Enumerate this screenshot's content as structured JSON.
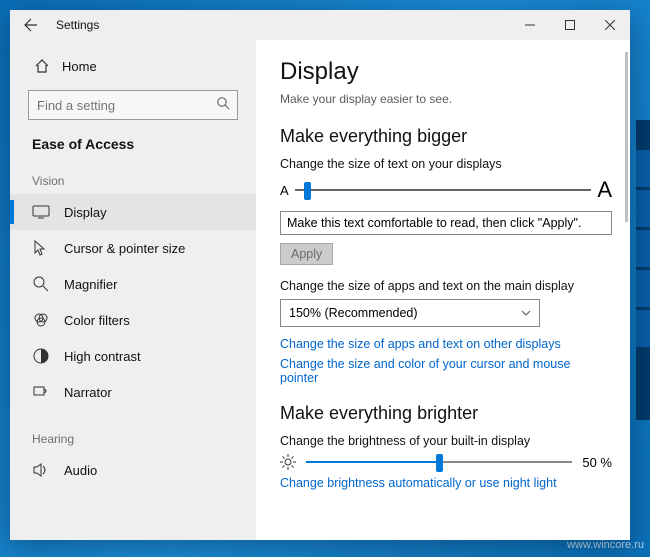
{
  "app_title": "Settings",
  "win": {
    "min": "—",
    "max": "□",
    "close": "✕"
  },
  "sidebar": {
    "home": "Home",
    "search_placeholder": "Find a setting",
    "category": "Ease of Access",
    "groups": [
      {
        "label": "Vision",
        "items": [
          {
            "id": "display",
            "label": "Display",
            "active": true
          },
          {
            "id": "cursor",
            "label": "Cursor & pointer size"
          },
          {
            "id": "magnifier",
            "label": "Magnifier"
          },
          {
            "id": "colorfilters",
            "label": "Color filters"
          },
          {
            "id": "highcontrast",
            "label": "High contrast"
          },
          {
            "id": "narrator",
            "label": "Narrator"
          }
        ]
      },
      {
        "label": "Hearing",
        "items": [
          {
            "id": "audio",
            "label": "Audio"
          }
        ]
      }
    ]
  },
  "main": {
    "title": "Display",
    "subtitle": "Make your display easier to see.",
    "bigger": {
      "heading": "Make everything bigger",
      "text_size_label": "Change the size of text on your displays",
      "preview": "Make this text comfortable to read, then click \"Apply\".",
      "apply": "Apply",
      "text_slider_pos": 3,
      "scale_label": "Change the size of apps and text on the main display",
      "scale_value": "150% (Recommended)",
      "link_other": "Change the size of apps and text on other displays",
      "link_cursor": "Change the size and color of your cursor and mouse pointer"
    },
    "brighter": {
      "heading": "Make everything brighter",
      "brightness_label": "Change the brightness of your built-in display",
      "brightness_pct": 50,
      "brightness_text": "50 %",
      "link_auto": "Change brightness automatically or use night light"
    }
  },
  "watermark": "www.wincore.ru"
}
